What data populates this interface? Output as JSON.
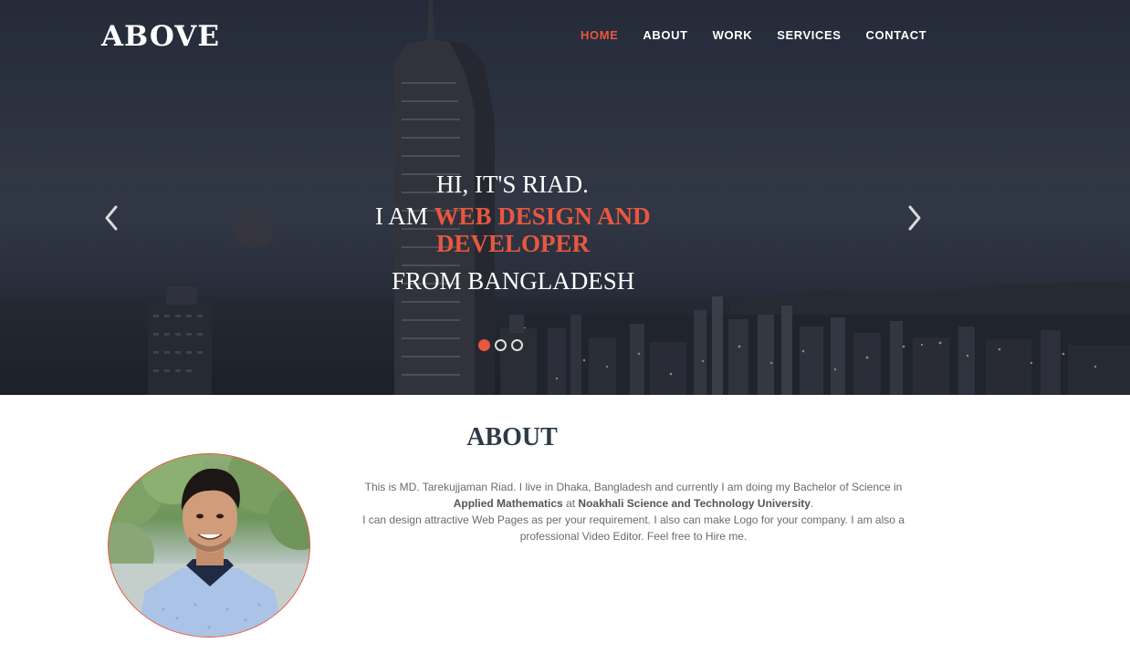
{
  "brand": {
    "logo": "ABOVE"
  },
  "nav": {
    "items": [
      {
        "label": "HOME",
        "active": true
      },
      {
        "label": "ABOUT",
        "active": false
      },
      {
        "label": "WORK",
        "active": false
      },
      {
        "label": "SERVICES",
        "active": false
      },
      {
        "label": "CONTACT",
        "active": false
      }
    ]
  },
  "hero": {
    "line1": "HI, IT'S RIAD.",
    "line2_prefix": "I AM ",
    "line2_highlight_a": "WEB DESIGN AND",
    "line2_highlight_b": "DEVELOPER",
    "line3": "FROM BANGLADESH",
    "slide_count": 3,
    "active_slide": 1,
    "prev_icon": "chevron-left-icon",
    "next_icon": "chevron-right-icon"
  },
  "about": {
    "title": "ABOUT",
    "text_1": "This is MD. Tarekujjaman Riad. I live in Dhaka, Bangladesh and currently I am doing my Bachelor of Science in",
    "text_2_bold_a": "Applied Mathematics",
    "text_2_mid": " at ",
    "text_2_bold_b": "Noakhali Science and Technology University",
    "text_2_end": ".",
    "text_3": "I can design attractive Web Pages as per your requirement. I also can make Logo for your company. I am also a professional Video Editor. Feel free to Hire me."
  },
  "colors": {
    "accent": "#e9573f",
    "heading": "#2f3a47",
    "body_text": "#6b6b6b",
    "hero_bg": "#343b4a"
  }
}
